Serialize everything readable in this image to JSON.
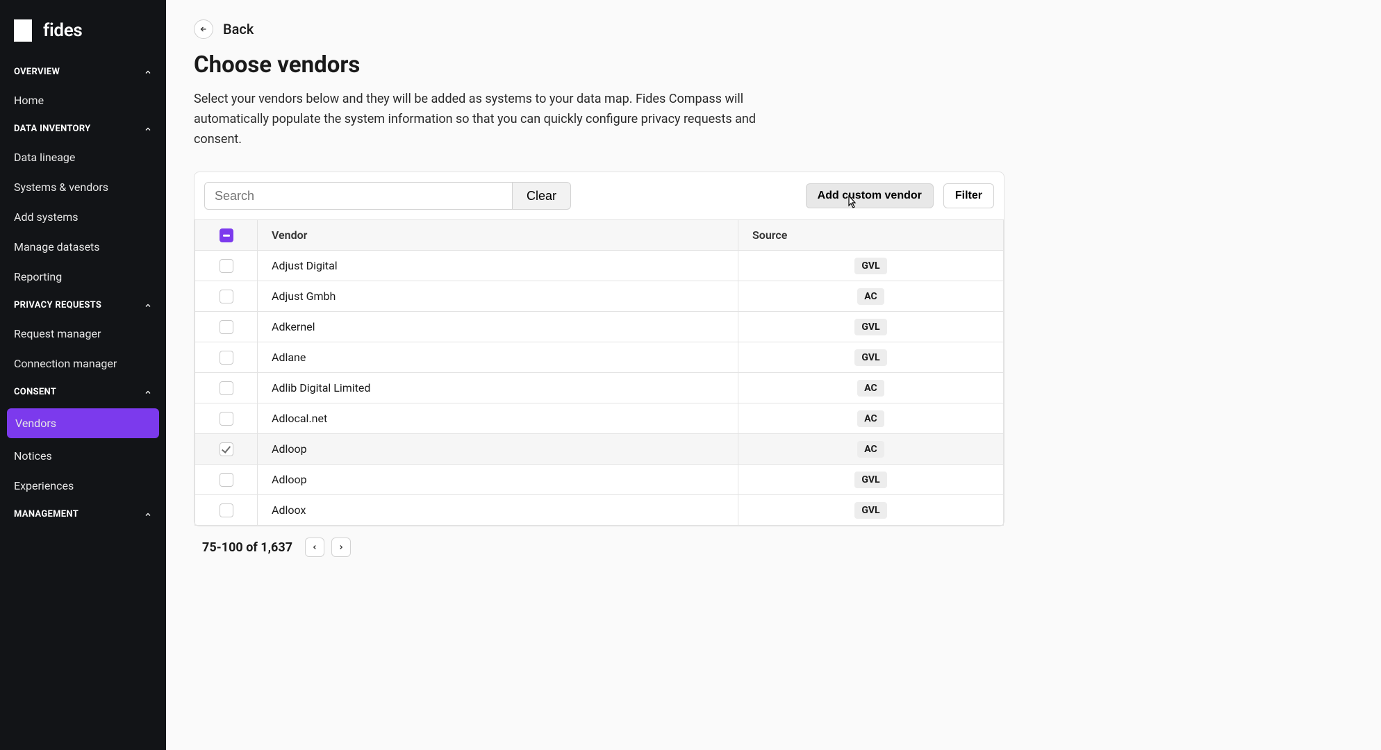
{
  "brand": {
    "name": "fides"
  },
  "sidebar": {
    "sections": [
      {
        "label": "OVERVIEW",
        "items": [
          {
            "label": "Home",
            "active": false
          }
        ]
      },
      {
        "label": "DATA INVENTORY",
        "items": [
          {
            "label": "Data lineage",
            "active": false
          },
          {
            "label": "Systems & vendors",
            "active": false
          },
          {
            "label": "Add systems",
            "active": false
          },
          {
            "label": "Manage datasets",
            "active": false
          },
          {
            "label": "Reporting",
            "active": false
          }
        ]
      },
      {
        "label": "PRIVACY REQUESTS",
        "items": [
          {
            "label": "Request manager",
            "active": false
          },
          {
            "label": "Connection manager",
            "active": false
          }
        ]
      },
      {
        "label": "CONSENT",
        "items": [
          {
            "label": "Vendors",
            "active": true
          },
          {
            "label": "Notices",
            "active": false
          },
          {
            "label": "Experiences",
            "active": false
          }
        ]
      },
      {
        "label": "MANAGEMENT",
        "items": []
      }
    ]
  },
  "header": {
    "back_label": "Back",
    "title": "Choose vendors",
    "description": "Select your vendors below and they will be added as systems to your data map. Fides Compass will automatically populate the system information so that you can quickly configure privacy requests and consent."
  },
  "toolbar": {
    "search_placeholder": "Search",
    "search_value": "",
    "clear_label": "Clear",
    "add_custom_label": "Add custom vendor",
    "filter_label": "Filter"
  },
  "table": {
    "headers": {
      "vendor": "Vendor",
      "source": "Source"
    },
    "select_all_state": "indeterminate",
    "rows": [
      {
        "vendor": "Adjust Digital",
        "source": "GVL",
        "checked": false
      },
      {
        "vendor": "Adjust Gmbh",
        "source": "AC",
        "checked": false
      },
      {
        "vendor": "Adkernel",
        "source": "GVL",
        "checked": false
      },
      {
        "vendor": "Adlane",
        "source": "GVL",
        "checked": false
      },
      {
        "vendor": "Adlib Digital Limited",
        "source": "AC",
        "checked": false
      },
      {
        "vendor": "Adlocal.net",
        "source": "AC",
        "checked": false
      },
      {
        "vendor": "Adloop",
        "source": "AC",
        "checked": true
      },
      {
        "vendor": "Adloop",
        "source": "GVL",
        "checked": false
      },
      {
        "vendor": "Adloox",
        "source": "GVL",
        "checked": false
      }
    ]
  },
  "pagination": {
    "range_text": "75-100 of 1,637"
  }
}
